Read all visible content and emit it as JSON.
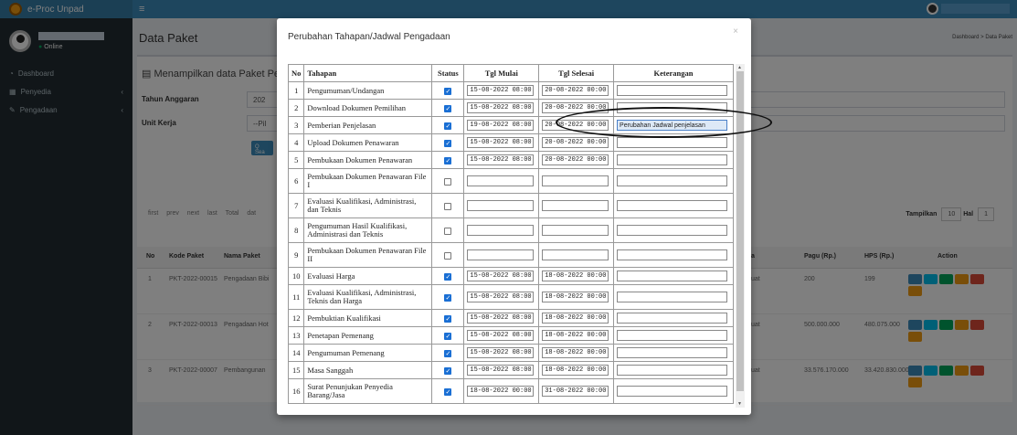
{
  "app": {
    "brand": "e-Proc Unpad",
    "online": "Online"
  },
  "sidebar": {
    "items": [
      {
        "label": "Dashboard",
        "icon": "dashboard-icon"
      },
      {
        "label": "Penyedia",
        "icon": "calendar-icon",
        "chevron": true
      },
      {
        "label": "Pengadaan",
        "icon": "edit-icon",
        "chevron": true
      }
    ]
  },
  "page": {
    "title": "Data Paket",
    "breadcrumb": "Dashboard > Data Paket",
    "box_title": "Menampilkan data Paket Penga"
  },
  "filters": {
    "tahun_label": "Tahun Anggaran",
    "tahun_value": "202",
    "unit_label": "Unit Kerja",
    "unit_value": "--Pil",
    "search_button": "Q Sea"
  },
  "pager": {
    "text": "first prev next last Total dat",
    "tampilkan": "Tampilkan",
    "tampilkan_value": "10",
    "hal": "Hal",
    "hal_value": "1"
  },
  "bg_table": {
    "headers": [
      "No",
      "Kode Paket",
      "Nama Paket",
      "a",
      "Pagu (Rp.)",
      "HPS (Rp.)",
      "Action"
    ],
    "rows": [
      {
        "no": "1",
        "kode": "PKT-2022-00015",
        "nama": "Pengadaan Bibi",
        "a": "uat",
        "pagu": "200",
        "hps": "199"
      },
      {
        "no": "2",
        "kode": "PKT-2022-00013",
        "nama": "Pengadaan Hot",
        "a": "uat",
        "pagu": "500.000.000",
        "hps": "480.075.000"
      },
      {
        "no": "3",
        "kode": "PKT-2022-00007",
        "nama": "Pembangunan",
        "a": "uat",
        "pagu": "33.576.170.000",
        "hps": "33.420.830.000"
      }
    ],
    "colors": {
      "blue": "#3c8dbc",
      "green": "#00a65a",
      "teal": "#00c0ef",
      "orange": "#f39c12",
      "red": "#dd4b39"
    }
  },
  "modal": {
    "title": "Perubahan Tahapan/Jadwal Pengadaan",
    "close": "×",
    "headers": {
      "no": "No",
      "tahapan": "Tahapan",
      "status": "Status",
      "mulai": "Tgl Mulai",
      "selesai": "Tgl Selesai",
      "ket": "Keterangan"
    },
    "rows": [
      {
        "no": "1",
        "tahapan": "Pengumuman/Undangan",
        "checked": true,
        "mulai": "15-08-2022 08:00",
        "selesai": "20-08-2022 00:00",
        "ket": ""
      },
      {
        "no": "2",
        "tahapan": "Download Dokumen Pemilihan",
        "checked": true,
        "mulai": "15-08-2022 08:00",
        "selesai": "20-08-2022 00:00",
        "ket": ""
      },
      {
        "no": "3",
        "tahapan": "Pemberian Penjelasan",
        "checked": true,
        "mulai": "19-08-2022 08:00",
        "selesai": "20-08-2022 00:00",
        "ket": "Perubahan Jadwal penjelasan",
        "highlight": true
      },
      {
        "no": "4",
        "tahapan": "Upload Dokumen Penawaran",
        "checked": true,
        "mulai": "15-08-2022 08:00",
        "selesai": "20-08-2022 00:00",
        "ket": ""
      },
      {
        "no": "5",
        "tahapan": "Pembukaan Dokumen Penawaran",
        "checked": true,
        "mulai": "15-08-2022 08:00",
        "selesai": "20-08-2022 00:00",
        "ket": ""
      },
      {
        "no": "6",
        "tahapan": "Pembukaan Dokumen Penawaran File I",
        "checked": false,
        "mulai": "",
        "selesai": "",
        "ket": ""
      },
      {
        "no": "7",
        "tahapan": "Evaluasi Kualifikasi, Administrasi, dan Teknis",
        "checked": false,
        "mulai": "",
        "selesai": "",
        "ket": ""
      },
      {
        "no": "8",
        "tahapan": "Pengumuman Hasil Kualifikasi, Administrasi dan Teknis",
        "checked": false,
        "mulai": "",
        "selesai": "",
        "ket": ""
      },
      {
        "no": "9",
        "tahapan": "Pembukaan Dokumen Penawaran File II",
        "checked": false,
        "mulai": "",
        "selesai": "",
        "ket": ""
      },
      {
        "no": "10",
        "tahapan": "Evaluasi Harga",
        "checked": true,
        "mulai": "15-08-2022 08:00",
        "selesai": "18-08-2022 00:00",
        "ket": ""
      },
      {
        "no": "11",
        "tahapan": "Evaluasi Kualifikasi, Administrasi, Teknis dan Harga",
        "checked": true,
        "mulai": "15-08-2022 08:00",
        "selesai": "18-08-2022 00:00",
        "ket": ""
      },
      {
        "no": "12",
        "tahapan": "Pembuktian Kualifikasi",
        "checked": true,
        "mulai": "15-08-2022 08:00",
        "selesai": "18-08-2022 00:00",
        "ket": ""
      },
      {
        "no": "13",
        "tahapan": "Penetapan Pemenang",
        "checked": true,
        "mulai": "15-08-2022 08:00",
        "selesai": "18-08-2022 00:00",
        "ket": ""
      },
      {
        "no": "14",
        "tahapan": "Pengumuman Pemenang",
        "checked": true,
        "mulai": "15-08-2022 08:00",
        "selesai": "18-08-2022 00:00",
        "ket": ""
      },
      {
        "no": "15",
        "tahapan": "Masa Sanggah",
        "checked": true,
        "mulai": "15-08-2022 08:00",
        "selesai": "18-08-2022 00:00",
        "ket": ""
      },
      {
        "no": "16",
        "tahapan": "Surat Penunjukan Penyedia Barang/Jasa",
        "checked": true,
        "mulai": "18-08-2022 00:00",
        "selesai": "31-08-2022 00:00",
        "ket": ""
      }
    ]
  }
}
